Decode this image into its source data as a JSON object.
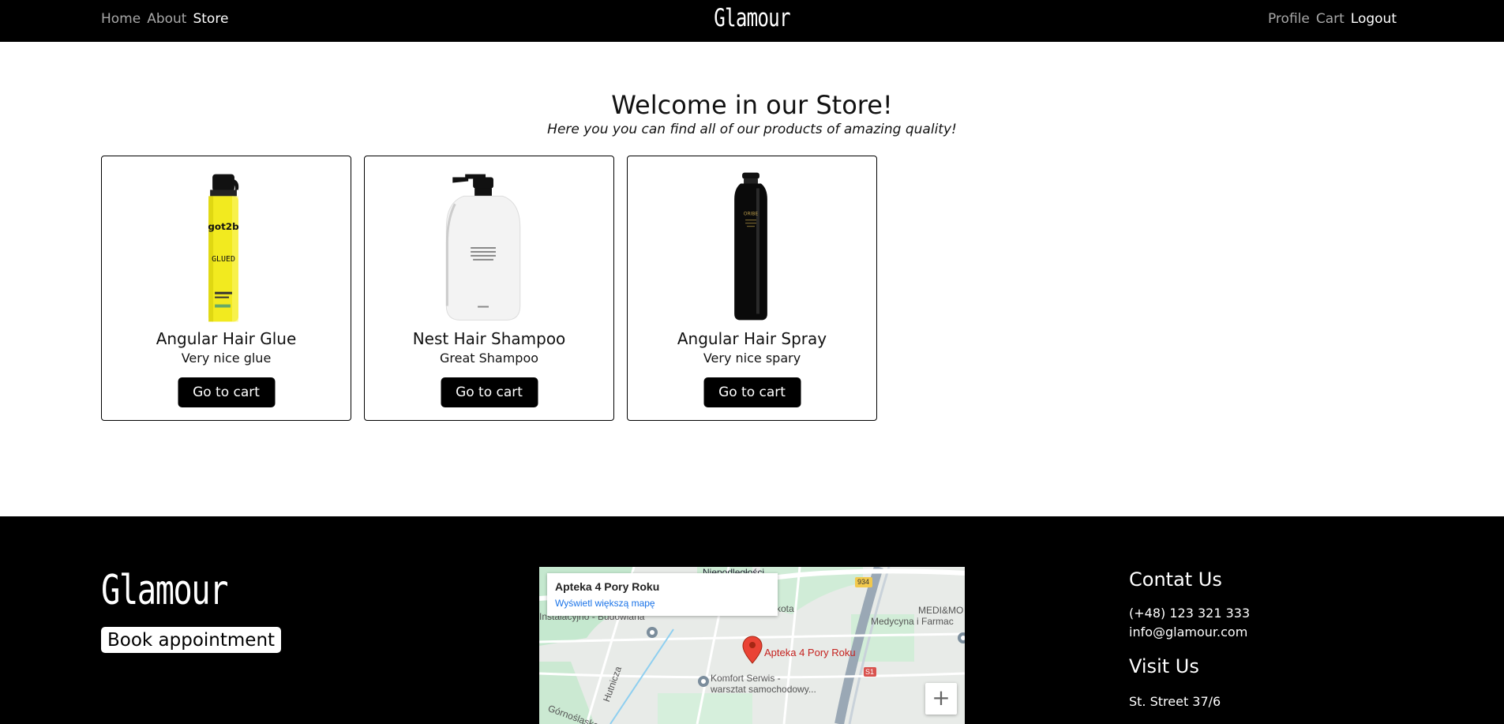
{
  "nav": {
    "left": [
      {
        "label": "Home",
        "active": false
      },
      {
        "label": "About",
        "active": false
      },
      {
        "label": "Store",
        "active": true
      }
    ],
    "brand": "Glamour",
    "right": [
      {
        "label": "Profile",
        "active": false
      },
      {
        "label": "Cart",
        "active": false
      },
      {
        "label": "Logout",
        "active": true
      }
    ]
  },
  "hero": {
    "title": "Welcome in our Store!",
    "subtitle": "Here you you can find all of our products of amazing quality!"
  },
  "products": [
    {
      "name": "Angular Hair Glue",
      "description": "Very nice glue",
      "button": "Go to cart",
      "image": "yellow-spray-bottle"
    },
    {
      "name": "Nest Hair Shampoo",
      "description": "Great Shampoo",
      "button": "Go to cart",
      "image": "white-pump-bottle"
    },
    {
      "name": "Angular Hair Spray",
      "description": "Very nice spary",
      "button": "Go to cart",
      "image": "black-spray-can"
    }
  ],
  "footer": {
    "brand": "Glamour",
    "book_button": "Book appointment",
    "map": {
      "place_title": "Apteka 4 Pory Roku",
      "view_larger": "Wyświetl większą mapę",
      "marker_label": "Apteka 4 Pory Roku",
      "labels": [
        "Niepodległości",
        "934",
        "Instalacyjno - Budowlana",
        "Komfort Serwis -",
        "warsztat samochodowy...",
        "MEDI&MO",
        "Medycyna i Farmac",
        "S1",
        "Hutnicza",
        "Górnośląska",
        "kota"
      ],
      "zoom_in": "+"
    },
    "contact_title": "Contat Us",
    "phone": "(+48) 123 321 333",
    "email": "info@glamour.com",
    "visit_title": "Visit Us",
    "address": "St. Street 37/6"
  },
  "colors": {
    "navbar_bg": "#000000",
    "footer_bg": "#000000",
    "button_bg": "#000000",
    "map_link": "#1a73e8",
    "map_marker": "#ea4335"
  }
}
